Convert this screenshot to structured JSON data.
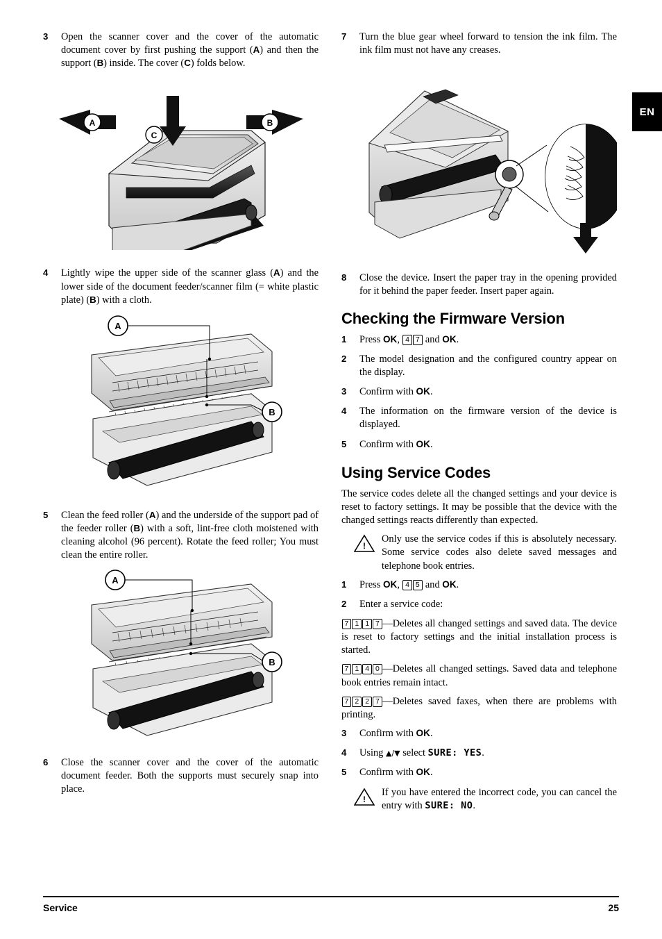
{
  "tab": {
    "label": "EN"
  },
  "footer": {
    "section": "Service",
    "page": "25"
  },
  "left_column": {
    "steps": [
      {
        "num": "3",
        "parts": [
          {
            "t": "Open the scanner cover and the cover of the automatic document cover by first pushing the support ("
          },
          {
            "t": "A",
            "bold": true
          },
          {
            "t": ") and then the support ("
          },
          {
            "t": "B",
            "bold": true
          },
          {
            "t": ") inside. The cover ("
          },
          {
            "t": "C",
            "bold": true
          },
          {
            "t": ") folds below."
          }
        ],
        "figure": "scanner-open-ABC"
      },
      {
        "num": "4",
        "parts": [
          {
            "t": "Lightly wipe the upper side of the scanner glass ("
          },
          {
            "t": "A",
            "bold": true
          },
          {
            "t": ") and the lower side of the document feeder/scanner film (= white plastic plate) ("
          },
          {
            "t": "B",
            "bold": true
          },
          {
            "t": ") with a cloth."
          }
        ],
        "figure": "scanner-glass-AB"
      },
      {
        "num": "5",
        "parts": [
          {
            "t": "Clean the feed roller ("
          },
          {
            "t": "A",
            "bold": true
          },
          {
            "t": ") and the underside of the support pad of the feeder roller ("
          },
          {
            "t": "B",
            "bold": true
          },
          {
            "t": ") with a soft, lint-free cloth moistened with cleaning alcohol (96 percent). Rotate the feed roller; You must clean the entire roller."
          }
        ],
        "figure": "feed-roller-AB"
      },
      {
        "num": "6",
        "parts": [
          {
            "t": "Close the scanner cover and the cover of the automatic document feeder. Both the supports must securely snap into place."
          }
        ],
        "figure": null
      }
    ],
    "figure_labels": {
      "fig3": [
        "A",
        "B",
        "C"
      ],
      "fig4": [
        "A",
        "B"
      ],
      "fig5": [
        "A",
        "B"
      ]
    }
  },
  "right_column": {
    "steps_top": [
      {
        "num": "7",
        "parts": [
          {
            "t": "Turn the blue gear wheel forward to tension the ink film. The ink film must not have any creases."
          }
        ]
      },
      {
        "num": "8",
        "parts": [
          {
            "t": "Close the device. Insert the paper tray in the opening provided for it behind the paper feeder. Insert paper again."
          }
        ]
      }
    ],
    "firmware": {
      "heading": "Checking the Firmware Version",
      "steps": [
        {
          "num": "1",
          "segments": [
            {
              "type": "text",
              "t": "Press "
            },
            {
              "type": "ok",
              "t": "OK"
            },
            {
              "type": "text",
              "t": ", "
            },
            {
              "type": "key",
              "t": "4"
            },
            {
              "type": "key",
              "t": "7"
            },
            {
              "type": "text",
              "t": " and "
            },
            {
              "type": "ok",
              "t": "OK"
            },
            {
              "type": "text",
              "t": "."
            }
          ]
        },
        {
          "num": "2",
          "segments": [
            {
              "type": "text",
              "t": "The model designation and the configured country appear on the display."
            }
          ]
        },
        {
          "num": "3",
          "segments": [
            {
              "type": "text",
              "t": "Confirm with "
            },
            {
              "type": "ok",
              "t": "OK"
            },
            {
              "type": "text",
              "t": "."
            }
          ]
        },
        {
          "num": "4",
          "segments": [
            {
              "type": "text",
              "t": "The information on the firmware version of the device is displayed."
            }
          ]
        },
        {
          "num": "5",
          "segments": [
            {
              "type": "text",
              "t": "Confirm with "
            },
            {
              "type": "ok",
              "t": "OK"
            },
            {
              "type": "text",
              "t": "."
            }
          ]
        }
      ]
    },
    "service_codes": {
      "heading": "Using Service Codes",
      "intro": "The service codes delete all the changed settings and your device is reset to factory settings. It may be possible that the device with the changed settings reacts differently than expected.",
      "warning1": "Only use the service codes if this is absolutely necessary. Some service codes also delete saved messages and telephone book entries.",
      "steps": [
        {
          "num": "1",
          "segments": [
            {
              "type": "text",
              "t": "Press "
            },
            {
              "type": "ok",
              "t": "OK"
            },
            {
              "type": "text",
              "t": ", "
            },
            {
              "type": "key",
              "t": "4"
            },
            {
              "type": "key",
              "t": "5"
            },
            {
              "type": "text",
              "t": " and "
            },
            {
              "type": "ok",
              "t": "OK"
            },
            {
              "type": "text",
              "t": "."
            }
          ]
        },
        {
          "num": "2",
          "segments": [
            {
              "type": "text",
              "t": "Enter a service code:"
            }
          ]
        }
      ],
      "codes": [
        {
          "keys": [
            "7",
            "1",
            "1",
            "7"
          ],
          "desc": "—Deletes all changed settings and saved data. The device is reset to factory settings and the initial installation process is started."
        },
        {
          "keys": [
            "7",
            "1",
            "4",
            "0"
          ],
          "desc": "—Deletes all changed settings. Saved data and telephone book entries remain intact."
        },
        {
          "keys": [
            "7",
            "2",
            "2",
            "7"
          ],
          "desc": "—Deletes saved faxes, when there are problems with printing."
        }
      ],
      "steps_after": [
        {
          "num": "3",
          "segments": [
            {
              "type": "text",
              "t": "Confirm with "
            },
            {
              "type": "ok",
              "t": "OK"
            },
            {
              "type": "text",
              "t": "."
            }
          ]
        },
        {
          "num": "4",
          "segments": [
            {
              "type": "text",
              "t": "Using "
            },
            {
              "type": "updown",
              "t": "▲/▼"
            },
            {
              "type": "text",
              "t": " select "
            },
            {
              "type": "disp",
              "t": "SURE: YES"
            },
            {
              "type": "text",
              "t": "."
            }
          ]
        },
        {
          "num": "5",
          "segments": [
            {
              "type": "text",
              "t": "Confirm with "
            },
            {
              "type": "ok",
              "t": "OK"
            },
            {
              "type": "text",
              "t": "."
            }
          ]
        }
      ],
      "warning2_pre": "If you have entered the incorrect code, you can cancel the entry with ",
      "warning2_disp": "SURE: NO",
      "warning2_post": "."
    },
    "figure_label_top": "ink-film-gear-wheel"
  }
}
